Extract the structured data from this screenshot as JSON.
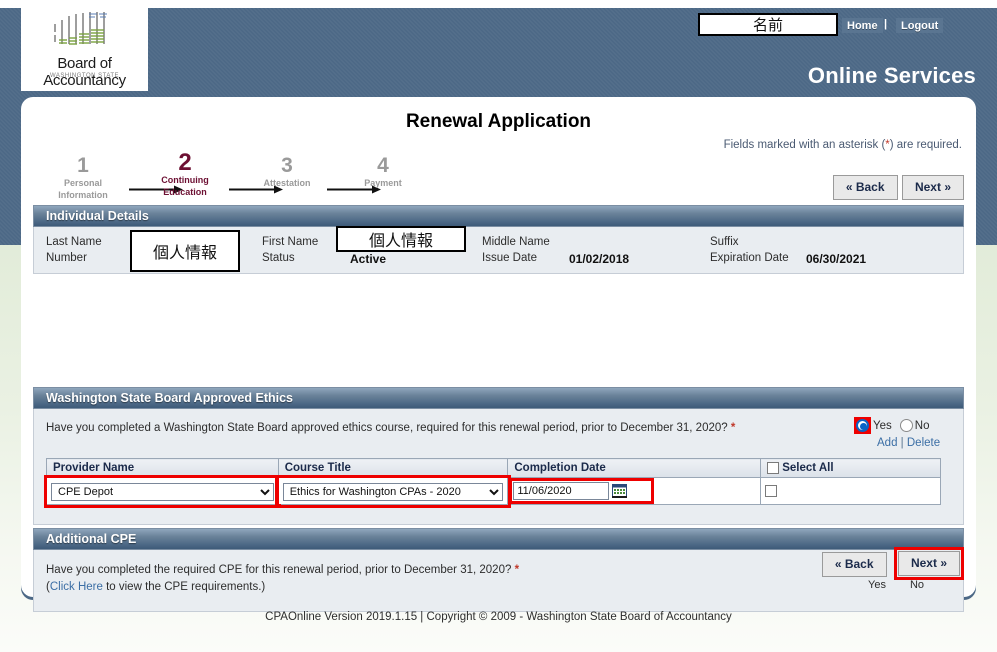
{
  "header": {
    "logo_title": "Board of Accountancy",
    "logo_subtitle": "WASHINGTON STATE",
    "name_box": "名前",
    "home_label": "Home",
    "separator": "|",
    "logout_label": "Logout",
    "online_services": "Online Services"
  },
  "page": {
    "title": "Renewal Application",
    "required_note_prefix": "Fields marked with an asterisk (",
    "required_note_asterisk": "*",
    "required_note_suffix": ") are required."
  },
  "steps": [
    {
      "num": "1",
      "label": "Personal\nInformation",
      "label_line1": "Personal",
      "label_line2": "Information",
      "state": "inactive"
    },
    {
      "num": "2",
      "label_line1": "Continuing",
      "label_line2": "Education",
      "state": "active"
    },
    {
      "num": "3",
      "label_line1": "Attestation",
      "label_line2": "",
      "state": "inactive"
    },
    {
      "num": "4",
      "label_line1": "Payment",
      "label_line2": "",
      "state": "inactive"
    }
  ],
  "nav": {
    "back_label": "« Back",
    "next_label": "Next »"
  },
  "individual_details": {
    "section_title": "Individual Details",
    "last_name_label": "Last Name",
    "last_name_value": "個人情報",
    "number_label": "Number",
    "first_name_label": "First Name",
    "first_name_value": "個人情報",
    "status_label": "Status",
    "status_value": "Active",
    "middle_name_label": "Middle Name",
    "issue_date_label": "Issue Date",
    "issue_date_value": "01/02/2018",
    "suffix_label": "Suffix",
    "expiration_date_label": "Expiration Date",
    "expiration_date_value": "06/30/2021"
  },
  "ethics": {
    "section_title": "Washington State Board Approved Ethics",
    "question": "Have you completed a Washington State Board approved ethics course, required for this renewal period, prior to December 31, 2020?",
    "asterisk": "*",
    "yes_label": "Yes",
    "no_label": "No",
    "selected": "Yes",
    "add_label": "Add",
    "link_separator": "|",
    "delete_label": "Delete",
    "columns": [
      "Provider Name",
      "Course Title",
      "Completion Date",
      "Select All"
    ],
    "select_all_label": "Select All",
    "rows": [
      {
        "provider_name": "CPE Depot",
        "course_title": "Ethics for Washington CPAs - 2020",
        "completion_date": "11/06/2020",
        "selected": false
      }
    ],
    "calendar_icon": "calendar-icon"
  },
  "additional_cpe": {
    "section_title": "Additional CPE",
    "question": "Have you completed the required CPE for this renewal period, prior to December 31, 2020?",
    "asterisk": "*",
    "subline_open": "(",
    "click_here_label": "Click Here",
    "subline_rest": " to view the CPE requirements.)",
    "yes_label": "Yes",
    "no_label": "No",
    "selected": "Yes"
  },
  "footer": {
    "text": "CPAOnline Version 2019.1.15 | Copyright © 2009 - Washington State Board of Accountancy"
  },
  "colors": {
    "header_blue": "#4c6886",
    "panel_header_dark": "#3d5a78",
    "active_step": "#6d1033",
    "highlight_red": "#ee0000",
    "required_asterisk": "#c0392b",
    "link_blue": "#3b6ea5",
    "page_bottom_green": "#e2ecd9"
  }
}
